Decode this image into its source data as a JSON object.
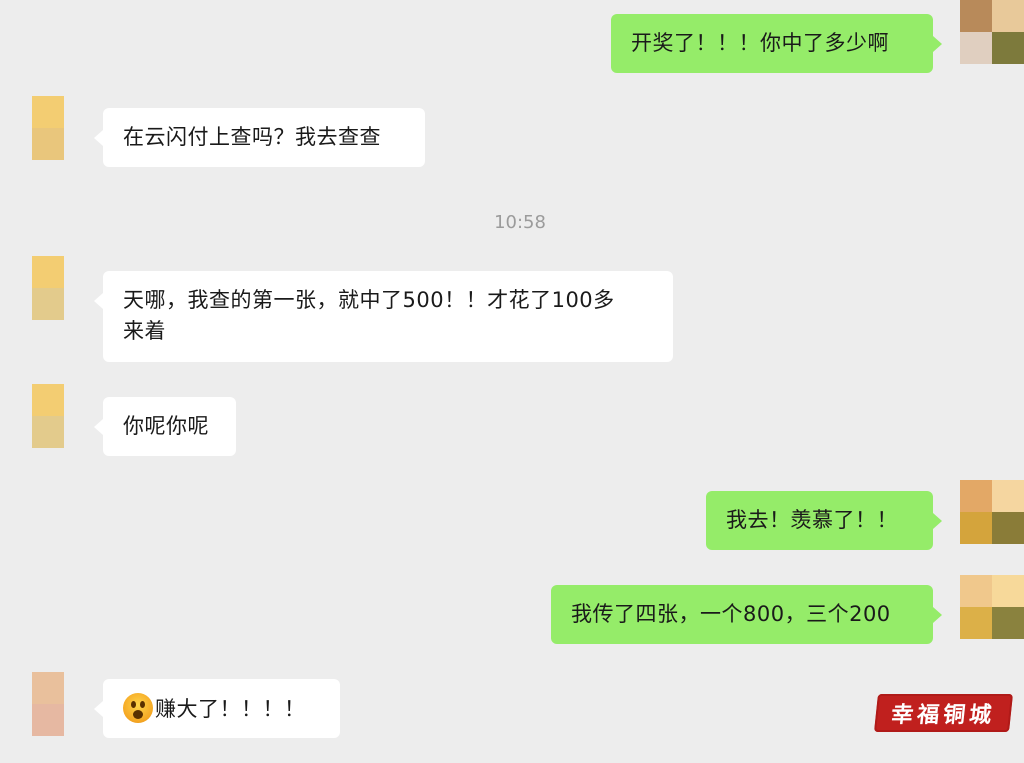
{
  "colors": {
    "background": "#ededed",
    "bubble_mine": "#95ec69",
    "bubble_other": "#ffffff",
    "timestamp_text": "#9b9b9b",
    "stamp": "#c0201e"
  },
  "messages": [
    {
      "sender": "self",
      "text": "开奖了！！！你中了多少啊"
    },
    {
      "sender": "other",
      "text": "在云闪付上查吗？我去查查"
    },
    {
      "type": "timestamp",
      "text": "10:58"
    },
    {
      "sender": "other",
      "text_line1": "天哪，我查的第一张，就中了500！！才花了100多",
      "text_line2": "来着"
    },
    {
      "sender": "other",
      "text": "你呢你呢"
    },
    {
      "sender": "self",
      "text": "我去！羡慕了！！"
    },
    {
      "sender": "self",
      "text": "我传了四张，一个800，三个200"
    },
    {
      "sender": "other",
      "emoji": "surprised-face-emoji",
      "text": "赚大了！！！！"
    }
  ],
  "watermark": {
    "text": "幸福铜城"
  }
}
